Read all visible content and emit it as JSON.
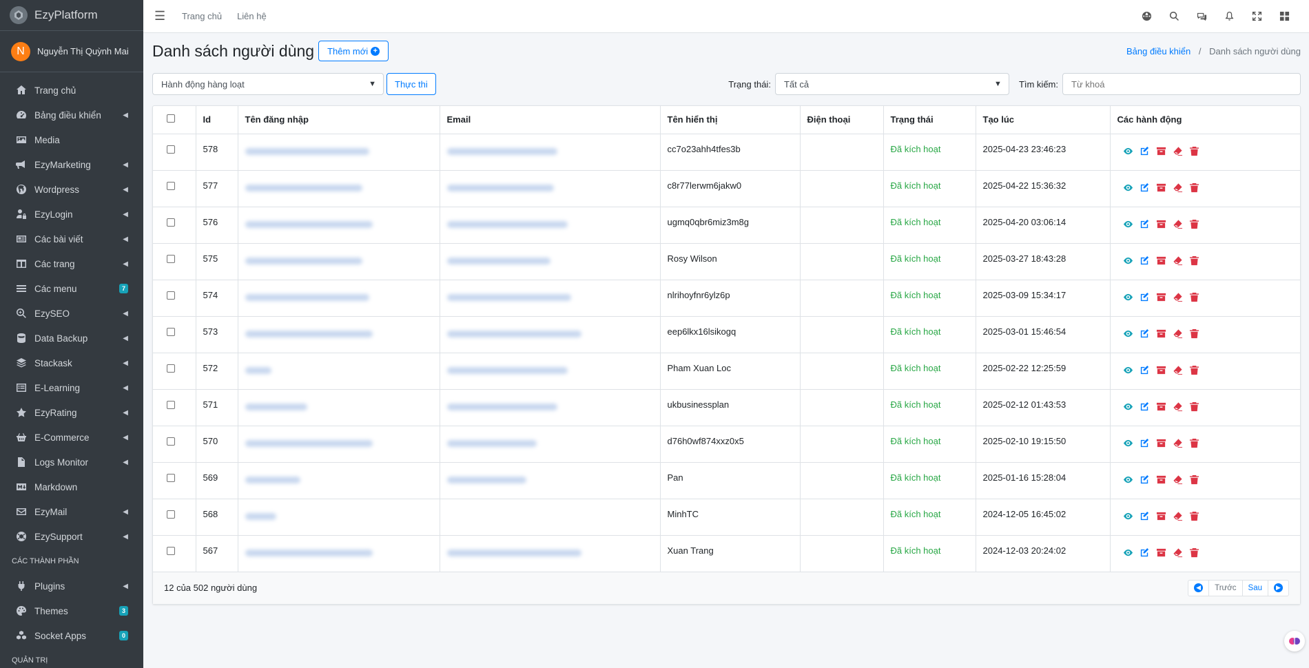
{
  "brand": {
    "name": "EzyPlatform"
  },
  "user": {
    "initial": "N",
    "name": "Nguyễn Thị Quỳnh Mai"
  },
  "sidebar": {
    "items": [
      {
        "label": "Trang chủ",
        "icon": "home-icon",
        "arrow": false,
        "badge": ""
      },
      {
        "label": "Bảng điều khiển",
        "icon": "dashboard-icon",
        "arrow": true,
        "badge": ""
      },
      {
        "label": "Media",
        "icon": "image-icon",
        "arrow": false,
        "badge": ""
      },
      {
        "label": "EzyMarketing",
        "icon": "megaphone-icon",
        "arrow": true,
        "badge": ""
      },
      {
        "label": "Wordpress",
        "icon": "wordpress-icon",
        "arrow": true,
        "badge": ""
      },
      {
        "label": "EzyLogin",
        "icon": "user-lock-icon",
        "arrow": true,
        "badge": ""
      },
      {
        "label": "Các bài viết",
        "icon": "newspaper-icon",
        "arrow": true,
        "badge": ""
      },
      {
        "label": "Các trang",
        "icon": "columns-icon",
        "arrow": true,
        "badge": ""
      },
      {
        "label": "Các menu",
        "icon": "bars-icon",
        "arrow": false,
        "badge": "7"
      },
      {
        "label": "EzySEO",
        "icon": "search-plus-icon",
        "arrow": true,
        "badge": ""
      },
      {
        "label": "Data Backup",
        "icon": "database-icon",
        "arrow": true,
        "badge": ""
      },
      {
        "label": "Stackask",
        "icon": "layers-icon",
        "arrow": true,
        "badge": ""
      },
      {
        "label": "E-Learning",
        "icon": "list-icon",
        "arrow": true,
        "badge": ""
      },
      {
        "label": "EzyRating",
        "icon": "star-icon",
        "arrow": true,
        "badge": ""
      },
      {
        "label": "E-Commerce",
        "icon": "basket-icon",
        "arrow": true,
        "badge": ""
      },
      {
        "label": "Logs Monitor",
        "icon": "file-icon",
        "arrow": true,
        "badge": ""
      },
      {
        "label": "Markdown",
        "icon": "markdown-icon",
        "arrow": false,
        "badge": ""
      },
      {
        "label": "EzyMail",
        "icon": "envelope-icon",
        "arrow": true,
        "badge": ""
      },
      {
        "label": "EzySupport",
        "icon": "life-ring-icon",
        "arrow": true,
        "badge": ""
      }
    ],
    "section1": "CÁC THÀNH PHẦN",
    "items2": [
      {
        "label": "Plugins",
        "icon": "plug-icon",
        "arrow": true,
        "badge": ""
      },
      {
        "label": "Themes",
        "icon": "palette-icon",
        "arrow": false,
        "badge": "3"
      },
      {
        "label": "Socket Apps",
        "icon": "cubes-icon",
        "arrow": false,
        "badge": "0"
      }
    ],
    "section2": "QUẢN TRỊ"
  },
  "topbar": {
    "link_home": "Trang chủ",
    "link_contact": "Liên hệ"
  },
  "header": {
    "title": "Danh sách người dùng",
    "add_label": "Thêm mới",
    "breadcrumb_home": "Bảng điều khiển",
    "breadcrumb_current": "Danh sách người dùng"
  },
  "filters": {
    "bulk_action": "Hành động hàng loạt",
    "execute": "Thực thi",
    "status_label": "Trạng thái:",
    "status_value": "Tất cả",
    "search_label": "Tìm kiếm:",
    "search_placeholder": "Từ khoá"
  },
  "table": {
    "columns": [
      "Id",
      "Tên đăng nhập",
      "Email",
      "Tên hiển thị",
      "Điện thoại",
      "Trạng thái",
      "Tạo lúc",
      "Các hành động"
    ],
    "rows": [
      {
        "id": "578",
        "display": "cc7o23ahh4tfes3b",
        "phone": "",
        "status": "Đã kích hoạt",
        "created": "2025-04-23 23:46:23"
      },
      {
        "id": "577",
        "display": "c8r77lerwm6jakw0",
        "phone": "",
        "status": "Đã kích hoạt",
        "created": "2025-04-22 15:36:32"
      },
      {
        "id": "576",
        "display": "ugmq0qbr6miz3m8g",
        "phone": "",
        "status": "Đã kích hoạt",
        "created": "2025-04-20 03:06:14"
      },
      {
        "id": "575",
        "display": "Rosy Wilson",
        "phone": "",
        "status": "Đã kích hoạt",
        "created": "2025-03-27 18:43:28"
      },
      {
        "id": "574",
        "display": "nlrihoyfnr6ylz6p",
        "phone": "",
        "status": "Đã kích hoạt",
        "created": "2025-03-09 15:34:17"
      },
      {
        "id": "573",
        "display": "eep6lkx16lsikogq",
        "phone": "",
        "status": "Đã kích hoạt",
        "created": "2025-03-01 15:46:54"
      },
      {
        "id": "572",
        "display": "Pham Xuan Loc",
        "phone": "",
        "status": "Đã kích hoạt",
        "created": "2025-02-22 12:25:59"
      },
      {
        "id": "571",
        "display": "ukbusinessplan",
        "phone": "",
        "status": "Đã kích hoạt",
        "created": "2025-02-12 01:43:53"
      },
      {
        "id": "570",
        "display": "d76h0wf874xxz0x5",
        "phone": "",
        "status": "Đã kích hoạt",
        "created": "2025-02-10 19:15:50"
      },
      {
        "id": "569",
        "display": "Pan",
        "phone": "",
        "status": "Đã kích hoạt",
        "created": "2025-01-16 15:28:04"
      },
      {
        "id": "568",
        "display": "MinhTC",
        "phone": "",
        "status": "Đã kích hoạt",
        "created": "2024-12-05 16:45:02"
      },
      {
        "id": "567",
        "display": "Xuan Trang",
        "phone": "",
        "status": "Đã kích hoạt",
        "created": "2024-12-03 20:24:02"
      }
    ]
  },
  "footer": {
    "summary": "12 của 502 người dùng",
    "prev": "Trước",
    "next": "Sau"
  },
  "colors": {
    "primary": "#007bff",
    "success": "#28a745",
    "danger": "#dc3545",
    "info": "#17a2b8",
    "sidebar": "#343a40"
  }
}
